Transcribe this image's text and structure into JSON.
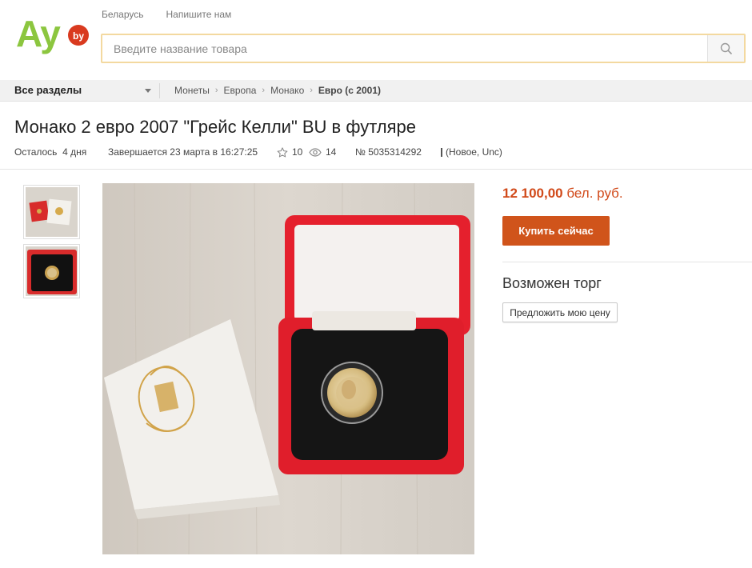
{
  "header": {
    "logo_text": "Ау",
    "logo_badge": "by",
    "region_link": "Беларусь",
    "contact_link": "Напишите нам",
    "search_placeholder": "Введите название товара",
    "search_icon": "search-icon"
  },
  "category_bar": {
    "all_sections": "Все разделы",
    "breadcrumbs": [
      "Монеты",
      "Европа",
      "Монако",
      "Евро (с 2001)"
    ]
  },
  "lot": {
    "title": "Монако 2 евро 2007 \"Грейс Келли\" BU в футляре",
    "time_left": "Осталось  4 дня",
    "ends": "Завершается 23 марта в 16:27:25",
    "favorites": "10",
    "views": "14",
    "lot_number": "№ 5035314292",
    "condition": "(Новое, Unc)"
  },
  "buy_box": {
    "price_amount": "12 100,00",
    "price_currency": "бел. руб.",
    "buy_button": "Купить сейчас",
    "bargain_title": "Возможен торг",
    "offer_button": "Предложить мою цену"
  },
  "colors": {
    "logo_green": "#8cc63f",
    "badge_red": "#d93a1f",
    "price": "#d14a1a",
    "buy_button": "#d0541b",
    "search_border": "#f3d9a0"
  }
}
